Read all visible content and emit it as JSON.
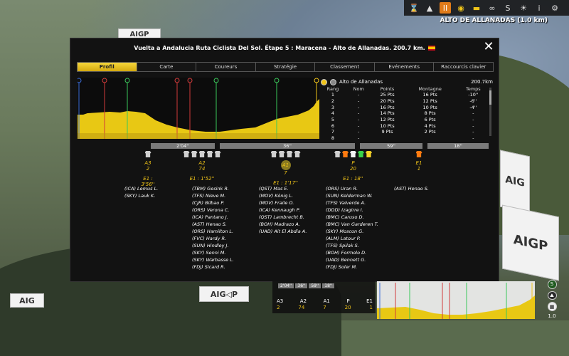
{
  "top_bar": {
    "icons": [
      "hourglass-icon",
      "speed-icon",
      "pause-icon",
      "eye-icon",
      "jersey-icon",
      "binoculars-icon",
      "s-logo-icon",
      "weather-icon",
      "info-icon",
      "settings-icon"
    ],
    "pause_label": "II",
    "s_label": "S",
    "info_label": "i"
  },
  "climb_info": "ALTO DE ALLANADAS (1.0 km)",
  "dialog": {
    "title": "Vuelta a Andalucia Ruta Ciclista Del Sol. Étape 5 : Maracena - Alto de Allanadas. 200.7 km.",
    "close": "✕"
  },
  "tabs": [
    "Profil",
    "Carte",
    "Coureurs",
    "Stratégie",
    "Classement",
    "Evénements",
    "Raccourcis clavier"
  ],
  "climb_panel": {
    "name": "Alto de Allanadas",
    "distance": "200.7km",
    "headers": [
      "Rang",
      "Nom",
      "Points",
      "Montagne",
      "Temps"
    ],
    "rows": [
      [
        "1",
        "-",
        "25 Pts",
        "16 Pts",
        "-10''"
      ],
      [
        "2",
        "-",
        "20 Pts",
        "12 Pts",
        "-6''"
      ],
      [
        "3",
        "-",
        "16 Pts",
        "10 Pts",
        "-4''"
      ],
      [
        "4",
        "-",
        "14 Pts",
        "8 Pts",
        "-"
      ],
      [
        "5",
        "-",
        "12 Pts",
        "6 Pts",
        "-"
      ],
      [
        "6",
        "-",
        "10 Pts",
        "4 Pts",
        "-"
      ],
      [
        "7",
        "-",
        "9 Pts",
        "2 Pts",
        "-"
      ],
      [
        "8",
        "-",
        "",
        "",
        "-"
      ]
    ]
  },
  "gaps": [
    "2'04''",
    "36''",
    "59''",
    "18''"
  ],
  "groups": [
    {
      "label": "A3",
      "count": "2",
      "time": "E1 : 3'56''",
      "riders": [
        "(ICA) Lemus L.",
        "(SKY) Lauk K."
      ]
    },
    {
      "label": "A2",
      "count": "74",
      "time": "E1 : 1'52''",
      "riders": [
        "(TBM) Gesink R.",
        "(TFS) Nieve M.",
        "(CJR) Bilbao P.",
        "(ORS) Verona C.",
        "(ICA) Pantano J.",
        "(AST) Henao S.",
        "(ORS) Hamilton L.",
        "(FVC) Hardy R.",
        "(SUN) Hindley J.",
        "(SKY) Senni M.",
        "(SKY) Warbasse L.",
        "(FDJ) Sicard R."
      ]
    },
    {
      "label": "A1",
      "count": "7",
      "time": "E1 : 1'17''",
      "riders": [
        "(QST) Mas E.",
        "(MOV) König L.",
        "(MOV) Fraile O.",
        "(ICA) Kennaugh P.",
        "(QST) Lambrecht B.",
        "(BOH) Madrazo A.",
        "(UAD) Ait El Abdia A."
      ]
    },
    {
      "label": "P",
      "count": "20",
      "time": "E1 : 18''",
      "riders": [
        "(ORS) Uran R.",
        "(SUN) Kelderman W.",
        "(TFS) Valverde A.",
        "(DDD) Izagirre I.",
        "(BMC) Caruso D.",
        "(BMC) Van Garderen T.",
        "(SKY) Moscon G.",
        "(ALM) Latour P.",
        "(TFS) Spilak S.",
        "(BOH) Formolo D.",
        "(UAD) Bennett G.",
        "(FDJ) Soler M."
      ]
    },
    {
      "label": "E1",
      "count": "1",
      "time": "",
      "riders": [
        "(AST) Henao S."
      ]
    }
  ],
  "mini_panel": {
    "gaps": [
      "2'04''",
      "36''",
      "59''",
      "18''"
    ],
    "labels": [
      "A3",
      "A2",
      "A1",
      "P",
      "E1"
    ],
    "counts": [
      "2",
      "74",
      "7",
      "20",
      "1"
    ]
  },
  "zoom_label": "1.0",
  "background_signs": [
    "AIGP",
    "AIG",
    "AIGP",
    "AIG",
    "AIG◁P"
  ]
}
